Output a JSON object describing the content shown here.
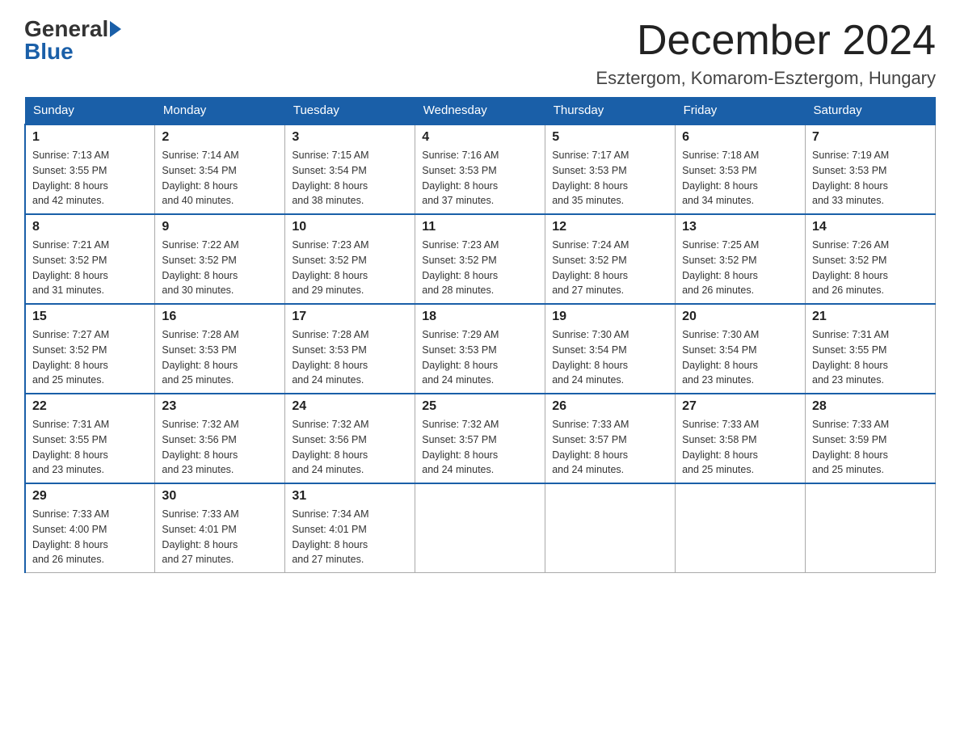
{
  "logo": {
    "general": "General",
    "blue": "Blue"
  },
  "title": "December 2024",
  "subtitle": "Esztergom, Komarom-Esztergom, Hungary",
  "days_of_week": [
    "Sunday",
    "Monday",
    "Tuesday",
    "Wednesday",
    "Thursday",
    "Friday",
    "Saturday"
  ],
  "weeks": [
    [
      {
        "day": "1",
        "sunrise": "7:13 AM",
        "sunset": "3:55 PM",
        "daylight": "8 hours and 42 minutes."
      },
      {
        "day": "2",
        "sunrise": "7:14 AM",
        "sunset": "3:54 PM",
        "daylight": "8 hours and 40 minutes."
      },
      {
        "day": "3",
        "sunrise": "7:15 AM",
        "sunset": "3:54 PM",
        "daylight": "8 hours and 38 minutes."
      },
      {
        "day": "4",
        "sunrise": "7:16 AM",
        "sunset": "3:53 PM",
        "daylight": "8 hours and 37 minutes."
      },
      {
        "day": "5",
        "sunrise": "7:17 AM",
        "sunset": "3:53 PM",
        "daylight": "8 hours and 35 minutes."
      },
      {
        "day": "6",
        "sunrise": "7:18 AM",
        "sunset": "3:53 PM",
        "daylight": "8 hours and 34 minutes."
      },
      {
        "day": "7",
        "sunrise": "7:19 AM",
        "sunset": "3:53 PM",
        "daylight": "8 hours and 33 minutes."
      }
    ],
    [
      {
        "day": "8",
        "sunrise": "7:21 AM",
        "sunset": "3:52 PM",
        "daylight": "8 hours and 31 minutes."
      },
      {
        "day": "9",
        "sunrise": "7:22 AM",
        "sunset": "3:52 PM",
        "daylight": "8 hours and 30 minutes."
      },
      {
        "day": "10",
        "sunrise": "7:23 AM",
        "sunset": "3:52 PM",
        "daylight": "8 hours and 29 minutes."
      },
      {
        "day": "11",
        "sunrise": "7:23 AM",
        "sunset": "3:52 PM",
        "daylight": "8 hours and 28 minutes."
      },
      {
        "day": "12",
        "sunrise": "7:24 AM",
        "sunset": "3:52 PM",
        "daylight": "8 hours and 27 minutes."
      },
      {
        "day": "13",
        "sunrise": "7:25 AM",
        "sunset": "3:52 PM",
        "daylight": "8 hours and 26 minutes."
      },
      {
        "day": "14",
        "sunrise": "7:26 AM",
        "sunset": "3:52 PM",
        "daylight": "8 hours and 26 minutes."
      }
    ],
    [
      {
        "day": "15",
        "sunrise": "7:27 AM",
        "sunset": "3:52 PM",
        "daylight": "8 hours and 25 minutes."
      },
      {
        "day": "16",
        "sunrise": "7:28 AM",
        "sunset": "3:53 PM",
        "daylight": "8 hours and 25 minutes."
      },
      {
        "day": "17",
        "sunrise": "7:28 AM",
        "sunset": "3:53 PM",
        "daylight": "8 hours and 24 minutes."
      },
      {
        "day": "18",
        "sunrise": "7:29 AM",
        "sunset": "3:53 PM",
        "daylight": "8 hours and 24 minutes."
      },
      {
        "day": "19",
        "sunrise": "7:30 AM",
        "sunset": "3:54 PM",
        "daylight": "8 hours and 24 minutes."
      },
      {
        "day": "20",
        "sunrise": "7:30 AM",
        "sunset": "3:54 PM",
        "daylight": "8 hours and 23 minutes."
      },
      {
        "day": "21",
        "sunrise": "7:31 AM",
        "sunset": "3:55 PM",
        "daylight": "8 hours and 23 minutes."
      }
    ],
    [
      {
        "day": "22",
        "sunrise": "7:31 AM",
        "sunset": "3:55 PM",
        "daylight": "8 hours and 23 minutes."
      },
      {
        "day": "23",
        "sunrise": "7:32 AM",
        "sunset": "3:56 PM",
        "daylight": "8 hours and 23 minutes."
      },
      {
        "day": "24",
        "sunrise": "7:32 AM",
        "sunset": "3:56 PM",
        "daylight": "8 hours and 24 minutes."
      },
      {
        "day": "25",
        "sunrise": "7:32 AM",
        "sunset": "3:57 PM",
        "daylight": "8 hours and 24 minutes."
      },
      {
        "day": "26",
        "sunrise": "7:33 AM",
        "sunset": "3:57 PM",
        "daylight": "8 hours and 24 minutes."
      },
      {
        "day": "27",
        "sunrise": "7:33 AM",
        "sunset": "3:58 PM",
        "daylight": "8 hours and 25 minutes."
      },
      {
        "day": "28",
        "sunrise": "7:33 AM",
        "sunset": "3:59 PM",
        "daylight": "8 hours and 25 minutes."
      }
    ],
    [
      {
        "day": "29",
        "sunrise": "7:33 AM",
        "sunset": "4:00 PM",
        "daylight": "8 hours and 26 minutes."
      },
      {
        "day": "30",
        "sunrise": "7:33 AM",
        "sunset": "4:01 PM",
        "daylight": "8 hours and 27 minutes."
      },
      {
        "day": "31",
        "sunrise": "7:34 AM",
        "sunset": "4:01 PM",
        "daylight": "8 hours and 27 minutes."
      },
      null,
      null,
      null,
      null
    ]
  ],
  "labels": {
    "sunrise": "Sunrise:",
    "sunset": "Sunset:",
    "daylight": "Daylight:"
  }
}
